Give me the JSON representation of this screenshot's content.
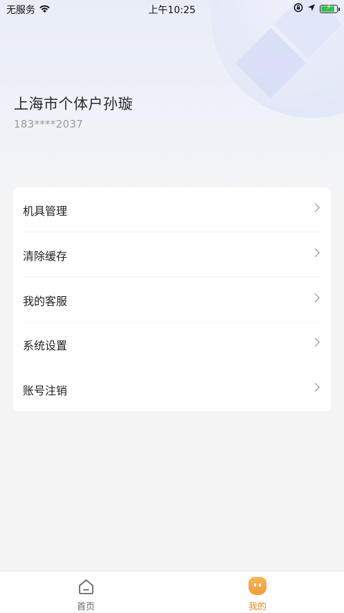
{
  "status_bar": {
    "carrier": "无服务",
    "time": "上午10:25",
    "wifi_icon": "wifi-icon",
    "lock_rotation_icon": "orientation-lock-icon",
    "location_icon": "location-arrow-icon",
    "battery_icon": "battery-charging-icon",
    "battery_color": "#35c24c"
  },
  "profile": {
    "name": "上海市个体户孙璇",
    "phone": "183****2037"
  },
  "menu": {
    "items": [
      {
        "label": "机具管理",
        "icon": "chevron-right-icon"
      },
      {
        "label": "清除缓存",
        "icon": "chevron-right-icon"
      },
      {
        "label": "我的客服",
        "icon": "chevron-right-icon"
      },
      {
        "label": "系统设置",
        "icon": "chevron-right-icon"
      },
      {
        "label": "账号注销",
        "icon": "chevron-right-icon"
      }
    ]
  },
  "tab_bar": {
    "tabs": [
      {
        "label": "首页",
        "icon": "home-icon",
        "active": false
      },
      {
        "label": "我的",
        "icon": "mine-face-icon",
        "active": true
      }
    ],
    "active_color": "#e8862a",
    "inactive_color": "#666666"
  }
}
